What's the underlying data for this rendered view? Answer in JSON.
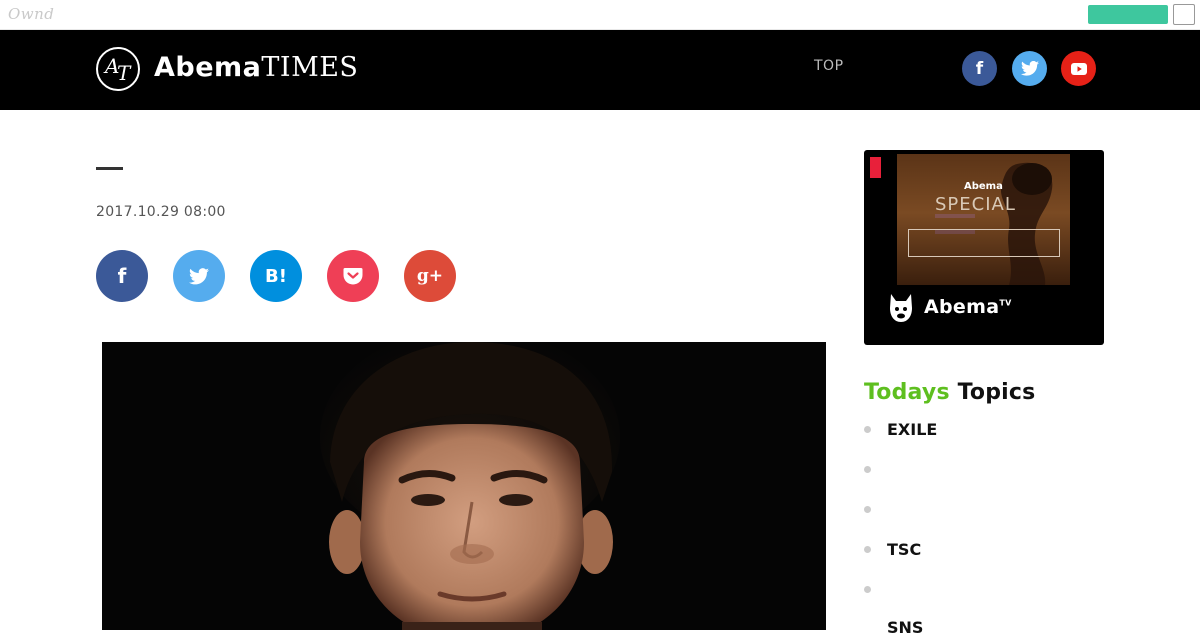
{
  "ownd_bar": {
    "logo": "Ownd"
  },
  "header": {
    "logo_mark_a": "A",
    "logo_mark_t": "T",
    "logo_abema": "Abema",
    "logo_times": "TIMES",
    "nav_top": "TOP",
    "social": {
      "facebook": "f",
      "twitter_icon": "bird-icon",
      "youtube_icon": "play-icon"
    }
  },
  "article": {
    "date": "2017.10.29 08:00",
    "share": {
      "facebook": "f",
      "hatena": "B!",
      "googleplus": "g+",
      "twitter_icon": "bird-icon",
      "pocket_icon": "pocket-icon"
    }
  },
  "ad": {
    "abema": "Abema",
    "special": "SPECIAL",
    "brand": "Abema",
    "brand_tv": "TV"
  },
  "todays_topics": {
    "heading_todays": "Todays",
    "heading_topics": "Topics",
    "items": [
      {
        "label": "EXILE"
      },
      {
        "label": ""
      },
      {
        "label": ""
      },
      {
        "label": "TSC"
      },
      {
        "label": ""
      },
      {
        "label": "SNS"
      }
    ]
  },
  "colors": {
    "header_bg": "#000000",
    "accent_green": "#5ebf1f",
    "ownd_green": "#3ec79e",
    "facebook": "#3b5998",
    "twitter": "#55acee",
    "youtube": "#e62117",
    "hatena": "#008fde",
    "pocket": "#ef3f56",
    "googleplus": "#dd4b39"
  }
}
